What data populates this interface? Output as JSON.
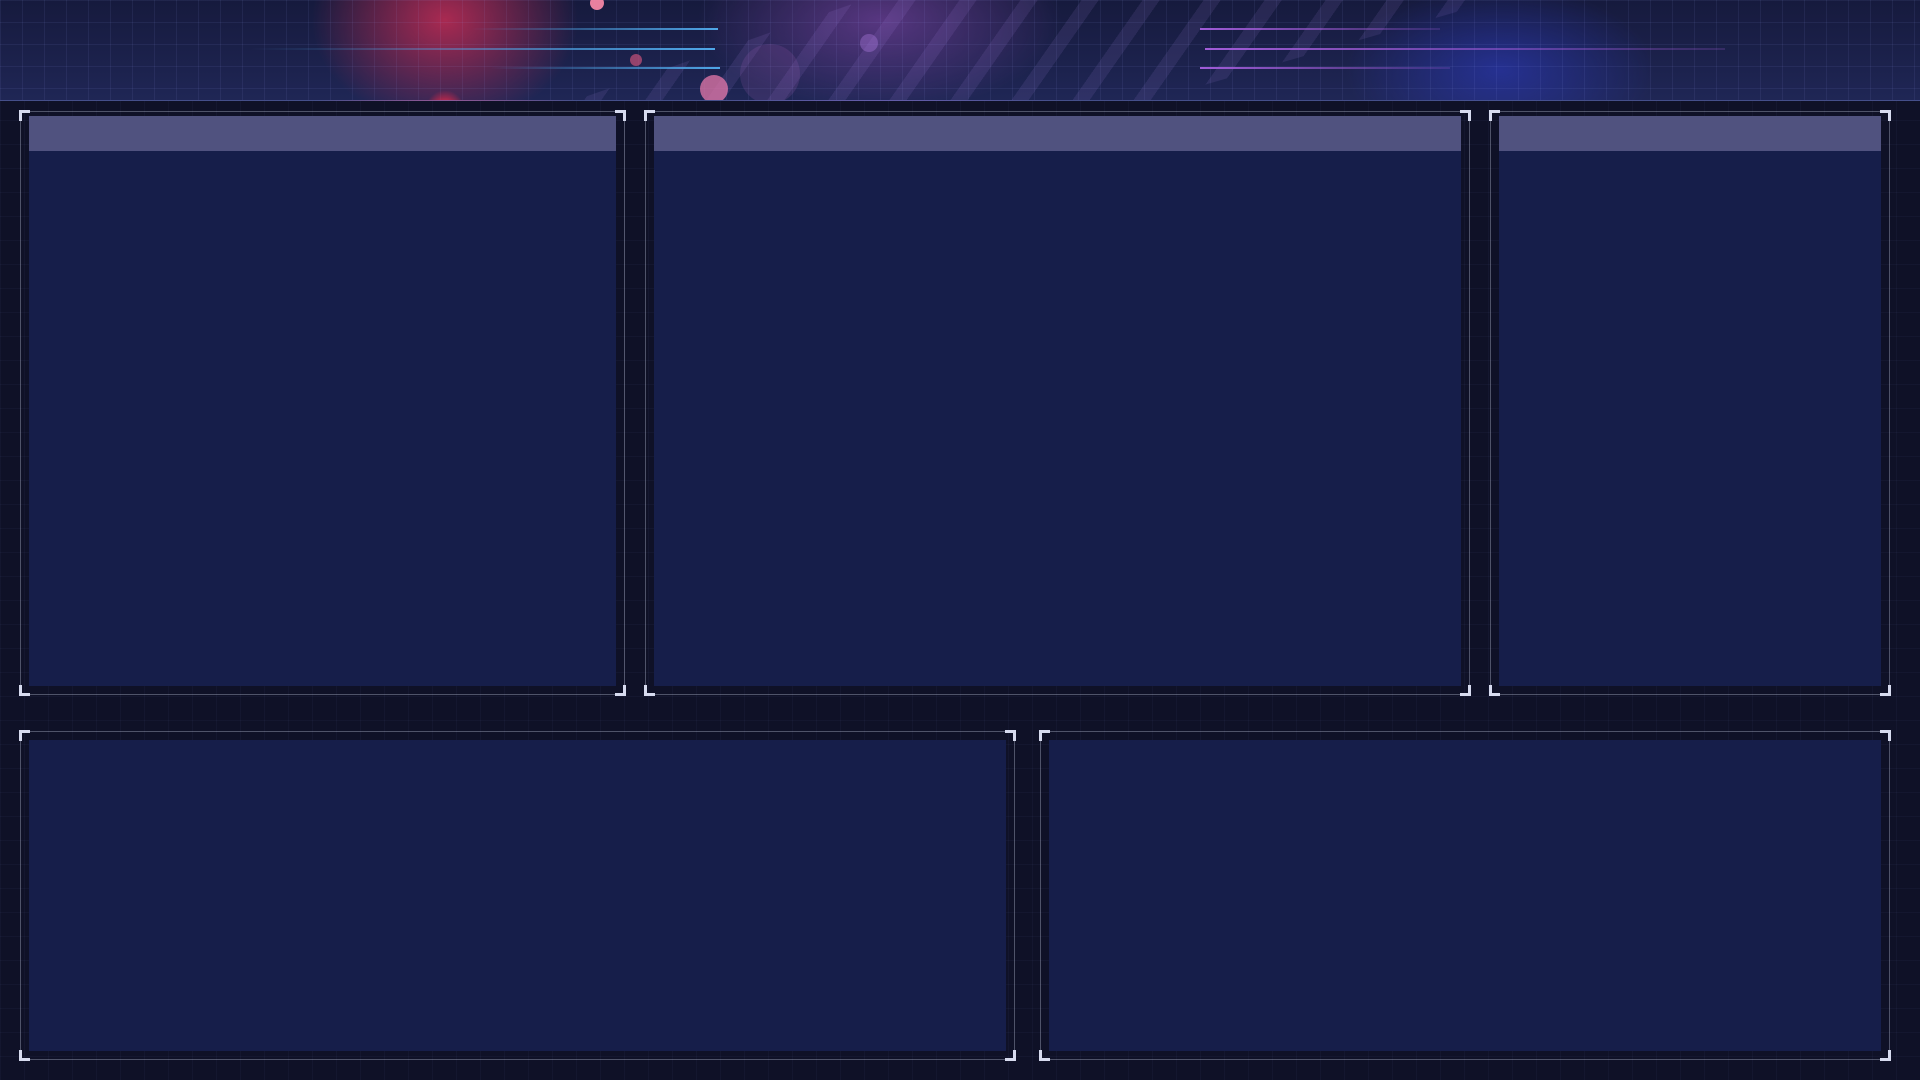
{
  "theme": {
    "background_color": "#0f1127",
    "panel_fill_color": "#161e4a",
    "panel_titlebar_color": "#50527f",
    "panel_border_color": "#c8cde6",
    "header_line_blue": "#4fa7e8",
    "header_line_purple": "#a15cd8",
    "header_glow_red": "#ff3c50"
  },
  "header": {
    "title": ""
  },
  "panels": {
    "top_left": {
      "title": ""
    },
    "top_center": {
      "title": ""
    },
    "top_right": {
      "title": ""
    },
    "bottom_left": {
      "title": ""
    },
    "bottom_right": {
      "title": ""
    }
  }
}
